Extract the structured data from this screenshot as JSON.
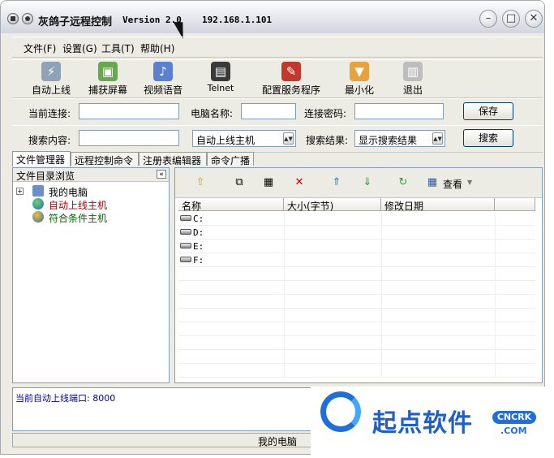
{
  "title": {
    "app": "灰鸽子远程控制",
    "version": "Version 2.0",
    "ip": "192.168.1.101"
  },
  "menu": [
    "文件(F)",
    "设置(G)",
    "工具(T)",
    "帮助(H)"
  ],
  "toolbar": [
    "自动上线",
    "捕获屏幕",
    "视频语音",
    "Telnet",
    "配置服务程序",
    "最小化",
    "退出"
  ],
  "connect": {
    "current_label": "当前连接:",
    "current_value": "",
    "pcname_label": "电脑名称:",
    "pcname_value": "",
    "password_label": "连接密码:",
    "password_value": "",
    "save_button": "保存"
  },
  "search": {
    "content_label": "搜索内容:",
    "content_value": "",
    "scope_selected": "自动上线主机",
    "result_label": "搜索结果:",
    "result_selected": "显示搜索结果",
    "search_button": "搜索"
  },
  "tabs": [
    "文件管理器",
    "远程控制命令",
    "注册表编辑器",
    "命令广播"
  ],
  "tree": {
    "header": "文件目录浏览",
    "collapse_glyph": "«",
    "items": [
      {
        "label": "我的电脑",
        "color": "#000000"
      },
      {
        "label": "自动上线主机",
        "color": "#b00000"
      },
      {
        "label": "符合条件主机",
        "color": "#006600"
      }
    ]
  },
  "filelist": {
    "view_label": "查看",
    "columns": [
      "名称",
      "大小(字节)",
      "修改日期"
    ],
    "rows": [
      "C:",
      "D:",
      "E:",
      "F:"
    ]
  },
  "log": {
    "line": "当前自动上线端口: 8000"
  },
  "status": {
    "text": "我的电脑"
  },
  "watermark": {
    "name": "起点软件",
    "badge": "CNCRK",
    "com": ".COM"
  }
}
